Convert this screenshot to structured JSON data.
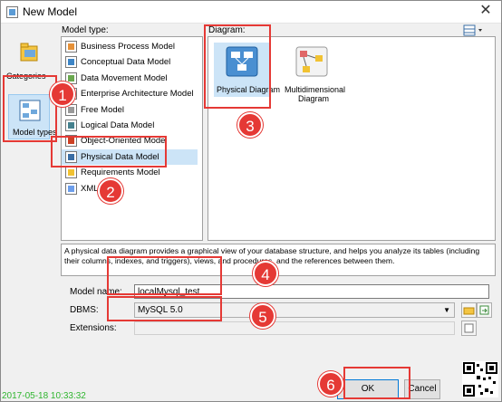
{
  "window": {
    "title": "New Model"
  },
  "left": {
    "categories_label": "Categories",
    "model_types_label": "Model types"
  },
  "model_type": {
    "header": "Model type:",
    "items": [
      {
        "label": "Business Process Model",
        "icon": "business-process-icon"
      },
      {
        "label": "Conceptual Data Model",
        "icon": "conceptual-data-icon"
      },
      {
        "label": "Data Movement Model",
        "icon": "data-movement-icon"
      },
      {
        "label": "Enterprise Architecture Model",
        "icon": "enterprise-architecture-icon"
      },
      {
        "label": "Free Model",
        "icon": "free-model-icon"
      },
      {
        "label": "Logical Data Model",
        "icon": "logical-data-icon"
      },
      {
        "label": "Object-Oriented Model",
        "icon": "object-oriented-icon"
      },
      {
        "label": "Physical Data Model",
        "icon": "physical-data-icon"
      },
      {
        "label": "Requirements Model",
        "icon": "requirements-icon"
      },
      {
        "label": "XML M",
        "icon": "xml-model-icon"
      }
    ],
    "selected_index": 7
  },
  "diagram": {
    "header": "Diagram:",
    "items": [
      {
        "label": "Physical Diagram"
      },
      {
        "label_line1": "Multidimensional",
        "label_line2": "Diagram"
      }
    ]
  },
  "description": "A physical data diagram provides a graphical view of your database structure, and helps you analyze its tables (including their columns, indexes, and triggers), views, and procedures, and the references between them.",
  "form": {
    "model_name_label": "Model name:",
    "model_name_value": "localMysql_test",
    "dbms_label": "DBMS:",
    "dbms_value": "MySQL 5.0",
    "extensions_label": "Extensions:"
  },
  "buttons": {
    "ok": "OK",
    "cancel": "Cancel"
  },
  "annotations": [
    "1",
    "2",
    "3",
    "4",
    "5",
    "6"
  ],
  "timestamp": "2017-05-18 10:33:32",
  "colors": {
    "annotation": "#e53935",
    "selection": "#cce4f7",
    "timestamp": "#2fb52f"
  }
}
